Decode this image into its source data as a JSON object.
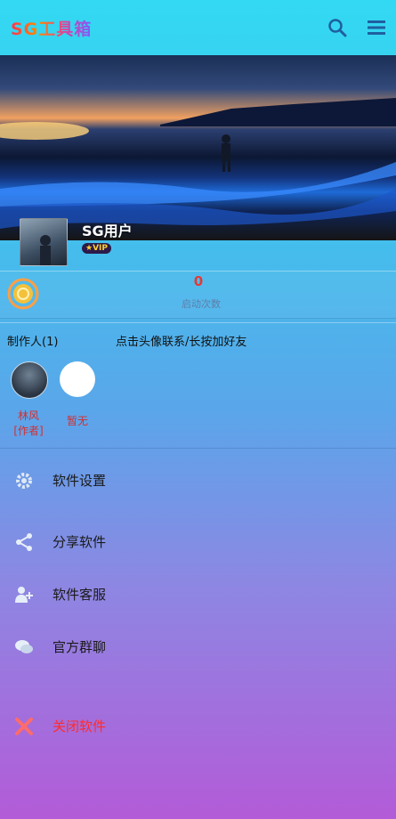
{
  "app": {
    "title": "SG工具箱"
  },
  "profile": {
    "username": "SG用户",
    "vip": "★VIP"
  },
  "stats": {
    "value": "0",
    "label": "启动次数"
  },
  "makers": {
    "title": "制作人(1)",
    "hint": "点击头像联系/长按加好友",
    "people": [
      {
        "name_line1": "林风",
        "name_line2": "[作者]"
      },
      {
        "name_line1": "暂无",
        "name_line2": ""
      }
    ]
  },
  "menu": [
    {
      "label": "软件设置",
      "icon": "gear-icon"
    },
    {
      "label": "分享软件",
      "icon": "share-icon"
    },
    {
      "label": "软件客服",
      "icon": "add-user-icon"
    },
    {
      "label": "官方群聊",
      "icon": "chat-icon"
    },
    {
      "label": "关闭软件",
      "icon": "close-icon"
    }
  ],
  "colors": {
    "accent_red": "#e53935",
    "close_red": "#ff2b2b"
  }
}
